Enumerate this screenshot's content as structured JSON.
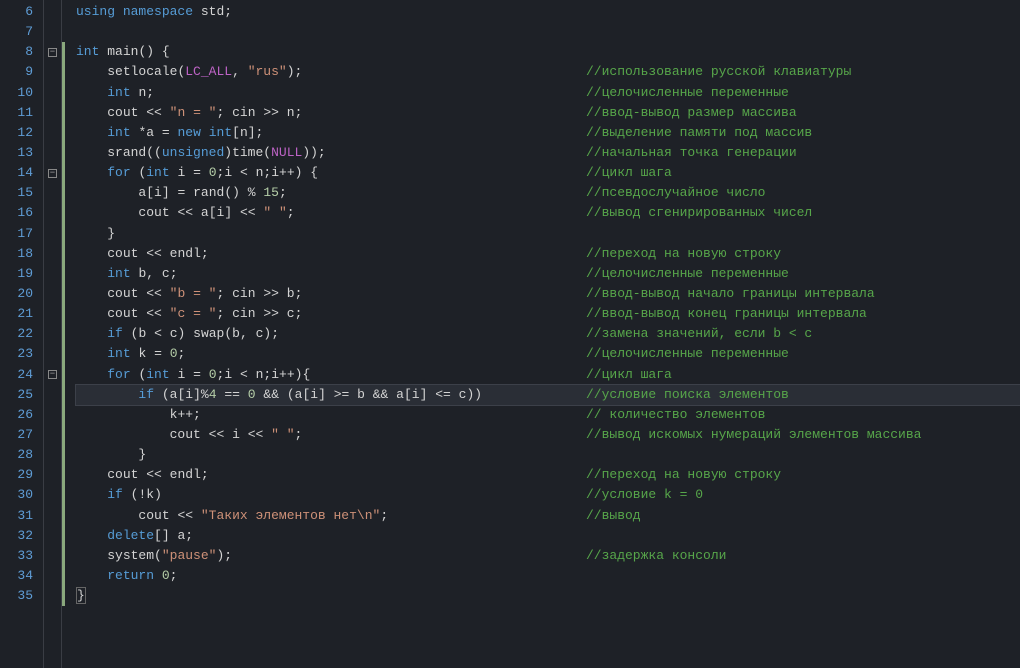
{
  "first_line_number": 6,
  "fold_markers": {
    "8": true,
    "14": true,
    "24": true
  },
  "highlighted_line": 25,
  "change_bar_lines": [
    8,
    9,
    10,
    11,
    12,
    13,
    14,
    15,
    16,
    17,
    18,
    19,
    20,
    21,
    22,
    23,
    24,
    25,
    26,
    27,
    28,
    29,
    30,
    31,
    32,
    33,
    34,
    35
  ],
  "lines": {
    "6": {
      "code": [
        [
          "kw",
          "using"
        ],
        [
          "ws",
          " "
        ],
        [
          "kw",
          "namespace"
        ],
        [
          "ws",
          " "
        ],
        [
          "id",
          "std"
        ],
        [
          "punct",
          ";"
        ]
      ],
      "indent": 0
    },
    "7": {
      "code": [],
      "indent": 0
    },
    "8": {
      "code": [
        [
          "type",
          "int"
        ],
        [
          "ws",
          " "
        ],
        [
          "fn",
          "main"
        ],
        [
          "punct",
          "()"
        ],
        [
          "ws",
          " "
        ],
        [
          "punct",
          "{"
        ]
      ],
      "indent": 0
    },
    "9": {
      "code": [
        [
          "fn",
          "setlocale"
        ],
        [
          "punct",
          "("
        ],
        [
          "macro",
          "LC_ALL"
        ],
        [
          "punct",
          ","
        ],
        [
          "ws",
          " "
        ],
        [
          "str",
          "\"rus\""
        ],
        [
          "punct",
          ");"
        ]
      ],
      "indent": 1,
      "comment": "//использование русской клавиатуры"
    },
    "10": {
      "code": [
        [
          "type",
          "int"
        ],
        [
          "ws",
          " "
        ],
        [
          "id",
          "n"
        ],
        [
          "punct",
          ";"
        ]
      ],
      "indent": 1,
      "comment": "//целочисленные переменные"
    },
    "11": {
      "code": [
        [
          "id",
          "cout"
        ],
        [
          "ws",
          " "
        ],
        [
          "op",
          "<<"
        ],
        [
          "ws",
          " "
        ],
        [
          "str",
          "\"n = \""
        ],
        [
          "punct",
          ";"
        ],
        [
          "ws",
          " "
        ],
        [
          "id",
          "cin"
        ],
        [
          "ws",
          " "
        ],
        [
          "op",
          ">>"
        ],
        [
          "ws",
          " "
        ],
        [
          "id",
          "n"
        ],
        [
          "punct",
          ";"
        ]
      ],
      "indent": 1,
      "comment": "//ввод-вывод размер массива"
    },
    "12": {
      "code": [
        [
          "type",
          "int"
        ],
        [
          "ws",
          " "
        ],
        [
          "op",
          "*"
        ],
        [
          "id",
          "a"
        ],
        [
          "ws",
          " "
        ],
        [
          "op",
          "="
        ],
        [
          "ws",
          " "
        ],
        [
          "kw",
          "new"
        ],
        [
          "ws",
          " "
        ],
        [
          "type",
          "int"
        ],
        [
          "punct",
          "["
        ],
        [
          "id",
          "n"
        ],
        [
          "punct",
          "];"
        ]
      ],
      "indent": 1,
      "comment": "//выделение памяти под массив"
    },
    "13": {
      "code": [
        [
          "fn",
          "srand"
        ],
        [
          "punct",
          "(("
        ],
        [
          "type",
          "unsigned"
        ],
        [
          "punct",
          ")"
        ],
        [
          "fn",
          "time"
        ],
        [
          "punct",
          "("
        ],
        [
          "const",
          "NULL"
        ],
        [
          "punct",
          "));"
        ]
      ],
      "indent": 1,
      "comment": "//начальная точка генерации"
    },
    "14": {
      "code": [
        [
          "kw",
          "for"
        ],
        [
          "ws",
          " "
        ],
        [
          "punct",
          "("
        ],
        [
          "type",
          "int"
        ],
        [
          "ws",
          " "
        ],
        [
          "id",
          "i"
        ],
        [
          "ws",
          " "
        ],
        [
          "op",
          "="
        ],
        [
          "ws",
          " "
        ],
        [
          "num",
          "0"
        ],
        [
          "punct",
          ";"
        ],
        [
          "id",
          "i"
        ],
        [
          "ws",
          " "
        ],
        [
          "op",
          "<"
        ],
        [
          "ws",
          " "
        ],
        [
          "id",
          "n"
        ],
        [
          "punct",
          ";"
        ],
        [
          "id",
          "i"
        ],
        [
          "op",
          "++"
        ],
        [
          "punct",
          ")"
        ],
        [
          "ws",
          " "
        ],
        [
          "punct",
          "{"
        ]
      ],
      "indent": 1,
      "comment": "//цикл шага"
    },
    "15": {
      "code": [
        [
          "id",
          "a"
        ],
        [
          "punct",
          "["
        ],
        [
          "id",
          "i"
        ],
        [
          "punct",
          "]"
        ],
        [
          "ws",
          " "
        ],
        [
          "op",
          "="
        ],
        [
          "ws",
          " "
        ],
        [
          "fn",
          "rand"
        ],
        [
          "punct",
          "()"
        ],
        [
          "ws",
          " "
        ],
        [
          "op",
          "%"
        ],
        [
          "ws",
          " "
        ],
        [
          "num",
          "15"
        ],
        [
          "punct",
          ";"
        ]
      ],
      "indent": 2,
      "comment": "//псевдослучайное число"
    },
    "16": {
      "code": [
        [
          "id",
          "cout"
        ],
        [
          "ws",
          " "
        ],
        [
          "op",
          "<<"
        ],
        [
          "ws",
          " "
        ],
        [
          "id",
          "a"
        ],
        [
          "punct",
          "["
        ],
        [
          "id",
          "i"
        ],
        [
          "punct",
          "]"
        ],
        [
          "ws",
          " "
        ],
        [
          "op",
          "<<"
        ],
        [
          "ws",
          " "
        ],
        [
          "str",
          "\" \""
        ],
        [
          "punct",
          ";"
        ]
      ],
      "indent": 2,
      "comment": "//вывод сгенирированных чисел"
    },
    "17": {
      "code": [
        [
          "punct",
          "}"
        ]
      ],
      "indent": 1
    },
    "18": {
      "code": [
        [
          "id",
          "cout"
        ],
        [
          "ws",
          " "
        ],
        [
          "op",
          "<<"
        ],
        [
          "ws",
          " "
        ],
        [
          "id",
          "endl"
        ],
        [
          "punct",
          ";"
        ]
      ],
      "indent": 1,
      "comment": "//переход на новую строку"
    },
    "19": {
      "code": [
        [
          "type",
          "int"
        ],
        [
          "ws",
          " "
        ],
        [
          "id",
          "b"
        ],
        [
          "punct",
          ","
        ],
        [
          "ws",
          " "
        ],
        [
          "id",
          "c"
        ],
        [
          "punct",
          ";"
        ]
      ],
      "indent": 1,
      "comment": "//целочисленные переменные"
    },
    "20": {
      "code": [
        [
          "id",
          "cout"
        ],
        [
          "ws",
          " "
        ],
        [
          "op",
          "<<"
        ],
        [
          "ws",
          " "
        ],
        [
          "str",
          "\"b = \""
        ],
        [
          "punct",
          ";"
        ],
        [
          "ws",
          " "
        ],
        [
          "id",
          "cin"
        ],
        [
          "ws",
          " "
        ],
        [
          "op",
          ">>"
        ],
        [
          "ws",
          " "
        ],
        [
          "id",
          "b"
        ],
        [
          "punct",
          ";"
        ]
      ],
      "indent": 1,
      "comment": "//ввод-вывод начало границы интервала"
    },
    "21": {
      "code": [
        [
          "id",
          "cout"
        ],
        [
          "ws",
          " "
        ],
        [
          "op",
          "<<"
        ],
        [
          "ws",
          " "
        ],
        [
          "str",
          "\"c = \""
        ],
        [
          "punct",
          ";"
        ],
        [
          "ws",
          " "
        ],
        [
          "id",
          "cin"
        ],
        [
          "ws",
          " "
        ],
        [
          "op",
          ">>"
        ],
        [
          "ws",
          " "
        ],
        [
          "id",
          "c"
        ],
        [
          "punct",
          ";"
        ]
      ],
      "indent": 1,
      "comment": "//ввод-вывод конец границы интервала"
    },
    "22": {
      "code": [
        [
          "kw",
          "if"
        ],
        [
          "ws",
          " "
        ],
        [
          "punct",
          "("
        ],
        [
          "id",
          "b"
        ],
        [
          "ws",
          " "
        ],
        [
          "op",
          "<"
        ],
        [
          "ws",
          " "
        ],
        [
          "id",
          "c"
        ],
        [
          "punct",
          ")"
        ],
        [
          "ws",
          " "
        ],
        [
          "fn",
          "swap"
        ],
        [
          "punct",
          "("
        ],
        [
          "id",
          "b"
        ],
        [
          "punct",
          ","
        ],
        [
          "ws",
          " "
        ],
        [
          "id",
          "c"
        ],
        [
          "punct",
          ");"
        ]
      ],
      "indent": 1,
      "comment": "//замена значений, если b < c"
    },
    "23": {
      "code": [
        [
          "type",
          "int"
        ],
        [
          "ws",
          " "
        ],
        [
          "id",
          "k"
        ],
        [
          "ws",
          " "
        ],
        [
          "op",
          "="
        ],
        [
          "ws",
          " "
        ],
        [
          "num",
          "0"
        ],
        [
          "punct",
          ";"
        ]
      ],
      "indent": 1,
      "comment": "//целочисленные переменные"
    },
    "24": {
      "code": [
        [
          "kw",
          "for"
        ],
        [
          "ws",
          " "
        ],
        [
          "punct",
          "("
        ],
        [
          "type",
          "int"
        ],
        [
          "ws",
          " "
        ],
        [
          "id",
          "i"
        ],
        [
          "ws",
          " "
        ],
        [
          "op",
          "="
        ],
        [
          "ws",
          " "
        ],
        [
          "num",
          "0"
        ],
        [
          "punct",
          ";"
        ],
        [
          "id",
          "i"
        ],
        [
          "ws",
          " "
        ],
        [
          "op",
          "<"
        ],
        [
          "ws",
          " "
        ],
        [
          "id",
          "n"
        ],
        [
          "punct",
          ";"
        ],
        [
          "id",
          "i"
        ],
        [
          "op",
          "++"
        ],
        [
          "punct",
          "){"
        ]
      ],
      "indent": 1,
      "comment": "//цикл шага"
    },
    "25": {
      "code": [
        [
          "kw",
          "if"
        ],
        [
          "ws",
          " "
        ],
        [
          "punct",
          "("
        ],
        [
          "id",
          "a"
        ],
        [
          "punct",
          "["
        ],
        [
          "id",
          "i"
        ],
        [
          "punct",
          "]"
        ],
        [
          "op",
          "%"
        ],
        [
          "num",
          "4"
        ],
        [
          "ws",
          " "
        ],
        [
          "op",
          "=="
        ],
        [
          "ws",
          " "
        ],
        [
          "num",
          "0"
        ],
        [
          "ws",
          " "
        ],
        [
          "op",
          "&&"
        ],
        [
          "ws",
          " "
        ],
        [
          "punct",
          "("
        ],
        [
          "id",
          "a"
        ],
        [
          "punct",
          "["
        ],
        [
          "id",
          "i"
        ],
        [
          "punct",
          "]"
        ],
        [
          "ws",
          " "
        ],
        [
          "op",
          ">="
        ],
        [
          "ws",
          " "
        ],
        [
          "id",
          "b"
        ],
        [
          "ws",
          " "
        ],
        [
          "op",
          "&&"
        ],
        [
          "ws",
          " "
        ],
        [
          "id",
          "a"
        ],
        [
          "punct",
          "["
        ],
        [
          "id",
          "i"
        ],
        [
          "punct",
          "]"
        ],
        [
          "ws",
          " "
        ],
        [
          "op",
          "<="
        ],
        [
          "ws",
          " "
        ],
        [
          "id",
          "c"
        ],
        [
          "punct",
          "))"
        ]
      ],
      "indent": 2,
      "comment": "//условие поиска элементов"
    },
    "26": {
      "code": [
        [
          "id",
          "k"
        ],
        [
          "op",
          "++"
        ],
        [
          "punct",
          ";"
        ]
      ],
      "indent": 3,
      "comment": "// количество элементов"
    },
    "27": {
      "code": [
        [
          "id",
          "cout"
        ],
        [
          "ws",
          " "
        ],
        [
          "op",
          "<<"
        ],
        [
          "ws",
          " "
        ],
        [
          "id",
          "i"
        ],
        [
          "ws",
          " "
        ],
        [
          "op",
          "<<"
        ],
        [
          "ws",
          " "
        ],
        [
          "str",
          "\" \""
        ],
        [
          "punct",
          ";"
        ]
      ],
      "indent": 3,
      "comment": "//вывод искомых нумераций элементов массива"
    },
    "28": {
      "code": [
        [
          "punct",
          "}"
        ]
      ],
      "indent": 2
    },
    "29": {
      "code": [
        [
          "id",
          "cout"
        ],
        [
          "ws",
          " "
        ],
        [
          "op",
          "<<"
        ],
        [
          "ws",
          " "
        ],
        [
          "id",
          "endl"
        ],
        [
          "punct",
          ";"
        ]
      ],
      "indent": 1,
      "comment": "//переход на новую строку"
    },
    "30": {
      "code": [
        [
          "kw",
          "if"
        ],
        [
          "ws",
          " "
        ],
        [
          "punct",
          "("
        ],
        [
          "op",
          "!"
        ],
        [
          "id",
          "k"
        ],
        [
          "punct",
          ")"
        ]
      ],
      "indent": 1,
      "comment": "//условие k = 0"
    },
    "31": {
      "code": [
        [
          "id",
          "cout"
        ],
        [
          "ws",
          " "
        ],
        [
          "op",
          "<<"
        ],
        [
          "ws",
          " "
        ],
        [
          "str",
          "\"Таких элементов нет\\n\""
        ],
        [
          "punct",
          ";"
        ]
      ],
      "indent": 2,
      "comment": "//вывод"
    },
    "32": {
      "code": [
        [
          "kw",
          "delete"
        ],
        [
          "punct",
          "[]"
        ],
        [
          "ws",
          " "
        ],
        [
          "id",
          "a"
        ],
        [
          "punct",
          ";"
        ]
      ],
      "indent": 1
    },
    "33": {
      "code": [
        [
          "fn",
          "system"
        ],
        [
          "punct",
          "("
        ],
        [
          "str",
          "\"pause\""
        ],
        [
          "punct",
          ");"
        ]
      ],
      "indent": 1,
      "comment": "//задержка консоли"
    },
    "34": {
      "code": [
        [
          "kw",
          "return"
        ],
        [
          "ws",
          " "
        ],
        [
          "num",
          "0"
        ],
        [
          "punct",
          ";"
        ]
      ],
      "indent": 1
    },
    "35": {
      "code": [
        [
          "punct",
          "}"
        ]
      ],
      "indent": 0,
      "brace_match": true
    }
  }
}
